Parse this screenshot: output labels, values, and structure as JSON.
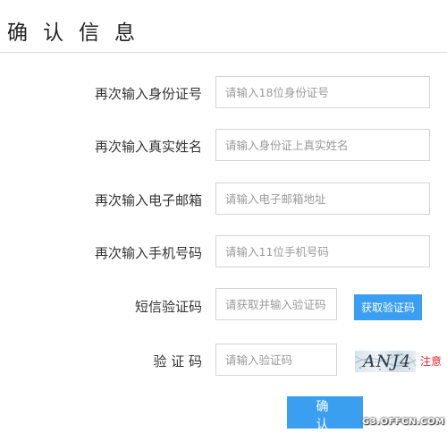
{
  "header": {
    "title": "确认信息"
  },
  "form": {
    "id_card": {
      "label": "再次输入身份证号",
      "placeholder": "请输入18位身份证号",
      "value": ""
    },
    "real_name": {
      "label": "再次输入真实姓名",
      "placeholder": "请输入身份证上真实姓名",
      "value": ""
    },
    "email": {
      "label": "再次输入电子邮箱",
      "placeholder": "请输入电子邮箱地址",
      "value": ""
    },
    "phone": {
      "label": "再次输入手机号码",
      "placeholder": "请输入11位手机号码",
      "value": ""
    },
    "sms_code": {
      "label": "短信验证码",
      "placeholder": "请获取并输入验证码",
      "value": "",
      "button": "获取验证码"
    },
    "captcha": {
      "label": "验 证 码",
      "placeholder": "请输入验证码",
      "value": "",
      "image_text": "ANJ4",
      "note": "注意"
    },
    "submit_label": "确 认"
  },
  "watermark": "G3.OFFCN.COM",
  "colors": {
    "accent": "#3a9ff0",
    "note_red": "#e0282f"
  }
}
